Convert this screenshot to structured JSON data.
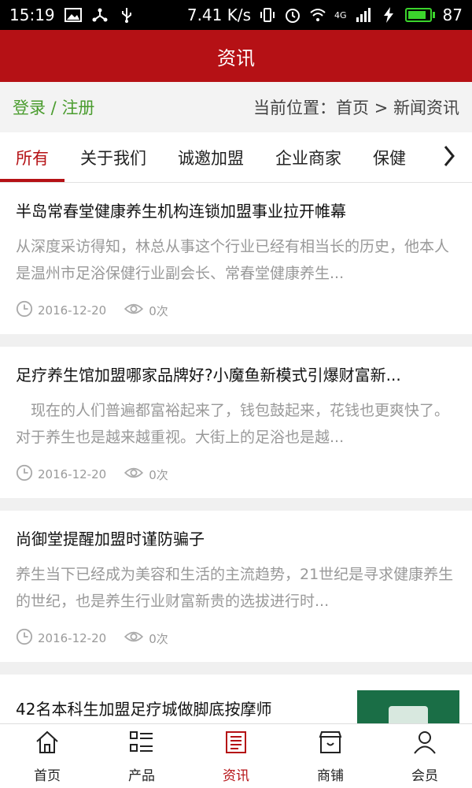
{
  "status_bar": {
    "time": "15:19",
    "speed": "7.41 K/s",
    "network": "4G",
    "battery": "87"
  },
  "header": {
    "title": "资讯"
  },
  "location": {
    "login": "登录",
    "separator": " / ",
    "register": "注册",
    "breadcrumb": "当前位置：首页 > 新闻资讯"
  },
  "tabs": [
    {
      "label": "所有",
      "active": true
    },
    {
      "label": "关于我们"
    },
    {
      "label": "诚邀加盟"
    },
    {
      "label": "企业商家"
    },
    {
      "label": "保健"
    }
  ],
  "articles": [
    {
      "title": "半岛常春堂健康养生机构连锁加盟事业拉开帷幕",
      "summary": "从深度采访得知，林总从事这个行业已经有相当长的历史，他本人是温州市足浴保健行业副会长、常春堂健康养生...",
      "date": "2016-12-20",
      "views": "0次"
    },
    {
      "title": "足疗养生馆加盟哪家品牌好?小魔鱼新模式引爆财富新...",
      "summary": "　现在的人们普遍都富裕起来了，钱包鼓起来，花钱也更爽快了。对于养生也是越来越重视。大街上的足浴也是越...",
      "date": "2016-12-20",
      "views": "0次"
    },
    {
      "title": "尚御堂提醒加盟时谨防骗子",
      "summary": "养生当下已经成为美容和生活的主流趋势，21世纪是寻求健康养生的世纪，也是养生行业财富新贵的选拔进行时...",
      "date": "2016-12-20",
      "views": "0次"
    },
    {
      "title": "42名本科生加盟足疗城做脚底按摩师"
    }
  ],
  "bottom_nav": [
    {
      "label": "首页",
      "icon": "home-icon"
    },
    {
      "label": "产品",
      "icon": "list-icon"
    },
    {
      "label": "资讯",
      "icon": "news-icon",
      "active": true
    },
    {
      "label": "商铺",
      "icon": "shop-icon"
    },
    {
      "label": "会员",
      "icon": "user-icon"
    }
  ],
  "colors": {
    "brand": "#b51115",
    "auth_green": "#4a9c2e",
    "battery": "#3bd42c"
  }
}
